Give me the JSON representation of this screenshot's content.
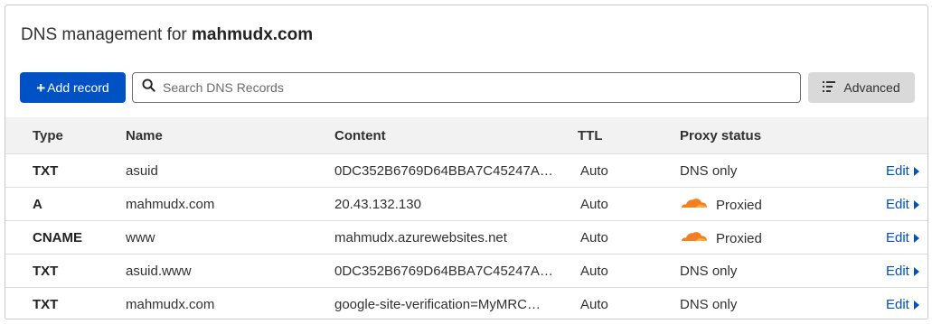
{
  "header": {
    "title_prefix": "DNS management for ",
    "domain": "mahmudx.com"
  },
  "toolbar": {
    "add_label": "Add record",
    "search_placeholder": "Search DNS Records",
    "advanced_label": "Advanced"
  },
  "table": {
    "columns": [
      "Type",
      "Name",
      "Content",
      "TTL",
      "Proxy status"
    ],
    "rows": [
      {
        "type": "TXT",
        "name": "asuid",
        "content": "0DC352B6769D64BBA7C45247A8…",
        "ttl": "Auto",
        "proxy": "DNS only",
        "proxied": false,
        "edit": "Edit"
      },
      {
        "type": "A",
        "name": "mahmudx.com",
        "content": "20.43.132.130",
        "ttl": "Auto",
        "proxy": "Proxied",
        "proxied": true,
        "edit": "Edit"
      },
      {
        "type": "CNAME",
        "name": "www",
        "content": "mahmudx.azurewebsites.net",
        "ttl": "Auto",
        "proxy": "Proxied",
        "proxied": true,
        "edit": "Edit"
      },
      {
        "type": "TXT",
        "name": "asuid.www",
        "content": "0DC352B6769D64BBA7C45247A8…",
        "ttl": "Auto",
        "proxy": "DNS only",
        "proxied": false,
        "edit": "Edit"
      },
      {
        "type": "TXT",
        "name": "mahmudx.com",
        "content": "google-site-verification=MyMRC…",
        "ttl": "Auto",
        "proxy": "DNS only",
        "proxied": false,
        "edit": "Edit"
      }
    ]
  },
  "colors": {
    "accent": "#0051c3",
    "proxy_cloud": "#f38020"
  },
  "icons": {
    "search": "search-icon",
    "advanced": "filter-list-icon",
    "proxied": "cloud-icon",
    "edit": "caret-right-icon"
  }
}
